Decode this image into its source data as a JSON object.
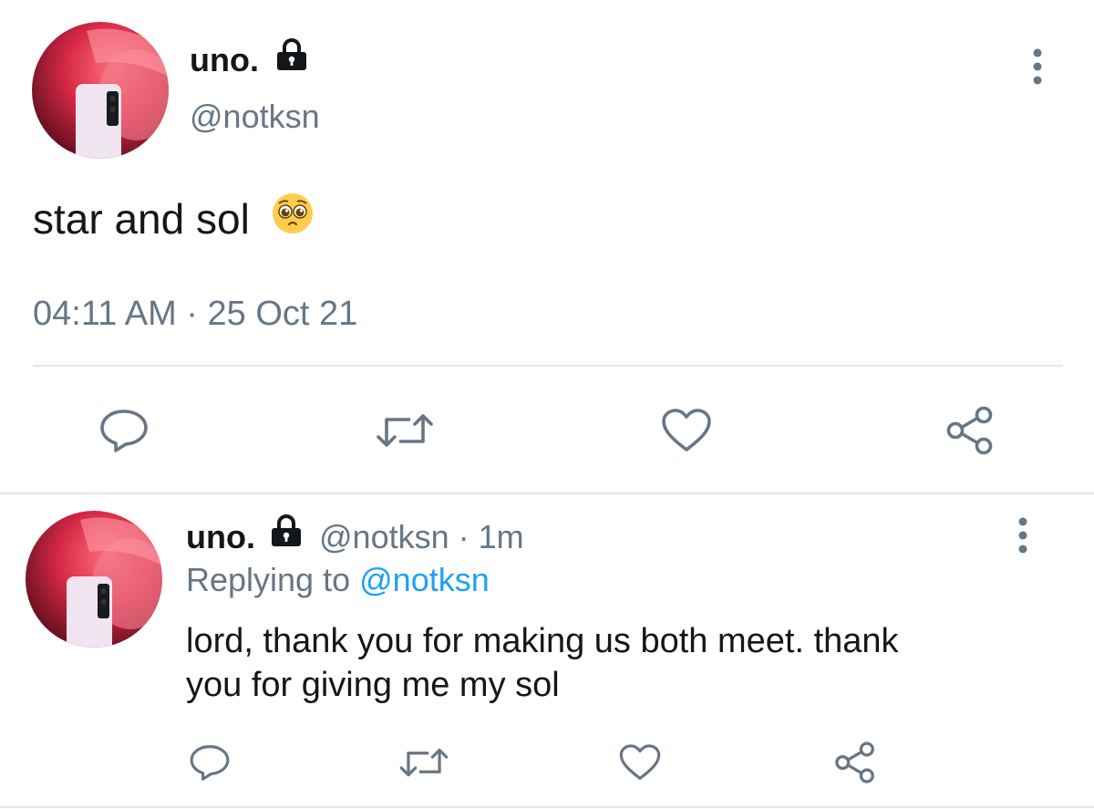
{
  "main_tweet": {
    "display_name": "uno.",
    "handle": "@notksn",
    "text": "star and sol",
    "emoji": "🥺",
    "timestamp": "04:11 AM · 25 Oct 21",
    "more_icon": "more-vertical-icon",
    "lock_icon": "lock-icon",
    "actions": [
      "reply-icon",
      "retweet-icon",
      "like-icon",
      "share-icon"
    ]
  },
  "reply_tweet": {
    "display_name": "uno.",
    "handle": "@notksn",
    "time_ago": "· 1m",
    "replying_label": "Replying to",
    "replying_to": "@notksn",
    "text_line1": "lord, thank you for making us both meet. thank",
    "text_line2": "you for giving me my sol",
    "more_icon": "more-vertical-icon",
    "lock_icon": "lock-icon",
    "actions": [
      "reply-icon",
      "retweet-icon",
      "like-icon",
      "share-icon"
    ]
  },
  "colors": {
    "text_primary": "#14171a",
    "text_muted": "#657786",
    "link": "#1da1f2",
    "icon": "#687684",
    "divider": "#e1e8ed"
  }
}
